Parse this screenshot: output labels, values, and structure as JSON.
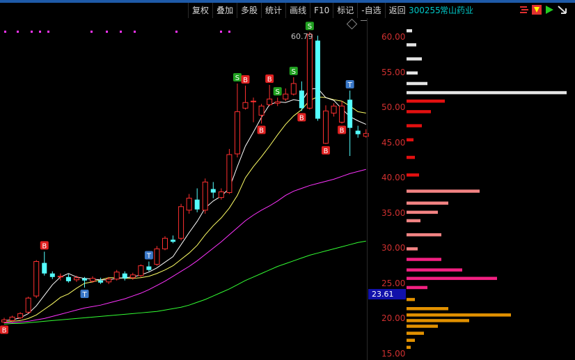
{
  "toolbar": {
    "buttons": [
      "复权",
      "叠加",
      "多股",
      "统计",
      "画线",
      "F10",
      "标记",
      "-自选",
      "返回"
    ]
  },
  "stock": {
    "code": "300255",
    "name": "常山药业"
  },
  "icons": [
    "grid-icon",
    "flag-icon",
    "play-icon",
    "arrow-icon"
  ],
  "colors": {
    "up": "#ff3030",
    "down": "#54ffff",
    "ma5": "#ffffff",
    "ma10": "#ffff66",
    "ma20": "#ff33ff",
    "ma60": "#33ff33",
    "axis": "#d03030"
  },
  "chart_data": {
    "type": "candlestick",
    "y_ticks": [
      "60.00",
      "55.00",
      "50.00",
      "45.00",
      "40.00",
      "35.00",
      "30.00",
      "25.00",
      "20.00",
      "15.00"
    ],
    "y_tick_values": [
      60,
      55,
      50,
      45,
      40,
      35,
      30,
      25,
      20,
      15
    ],
    "ylim": [
      14.2,
      62.8
    ],
    "max_price_label": "60.79",
    "current_price_label": "23.61",
    "candles": [
      [
        19.6,
        19.9,
        19.4,
        20.2
      ],
      [
        19.8,
        20.3,
        19.6,
        20.5
      ],
      [
        20.2,
        20.8,
        20.0,
        21.0
      ],
      [
        21.0,
        23.0,
        20.8,
        23.2
      ],
      [
        23.3,
        28.2,
        23.0,
        28.4
      ],
      [
        28.0,
        26.5,
        26.2,
        29.6
      ],
      [
        26.5,
        26.0,
        25.7,
        26.8
      ],
      [
        26.0,
        26.1,
        25.5,
        26.5
      ],
      [
        26.0,
        25.4,
        25.2,
        26.4
      ],
      [
        25.6,
        25.9,
        25.3,
        26.2
      ],
      [
        25.8,
        25.5,
        24.5,
        26.0
      ],
      [
        25.4,
        25.8,
        25.2,
        26.1
      ],
      [
        25.5,
        25.2,
        25.0,
        25.9
      ],
      [
        25.3,
        25.7,
        25.0,
        26.0
      ],
      [
        25.7,
        26.7,
        25.5,
        27.0
      ],
      [
        26.5,
        25.8,
        25.5,
        26.8
      ],
      [
        25.9,
        26.3,
        25.6,
        26.6
      ],
      [
        26.2,
        27.6,
        26.0,
        27.8
      ],
      [
        27.5,
        27.0,
        26.8,
        28.2
      ],
      [
        27.8,
        30.0,
        27.6,
        30.4
      ],
      [
        30.0,
        31.5,
        29.8,
        31.8
      ],
      [
        31.3,
        31.0,
        30.8,
        31.9
      ],
      [
        31.5,
        36.0,
        31.2,
        36.4
      ],
      [
        35.5,
        37.2,
        35.0,
        37.8
      ],
      [
        37.0,
        35.6,
        35.2,
        38.6
      ],
      [
        35.5,
        39.5,
        35.0,
        40.0
      ],
      [
        38.5,
        38.0,
        37.2,
        39.5
      ],
      [
        37.3,
        38.1,
        37.0,
        38.6
      ],
      [
        38.0,
        43.4,
        37.8,
        44.2
      ],
      [
        43.5,
        49.5,
        43.0,
        53.5
      ],
      [
        50.0,
        50.8,
        49.8,
        53.2
      ],
      [
        51.0,
        51.0,
        48.0,
        51.5
      ],
      [
        49.0,
        50.3,
        47.8,
        50.6
      ],
      [
        50.5,
        51.3,
        50.3,
        53.3
      ],
      [
        50.7,
        50.9,
        50.3,
        51.5
      ],
      [
        51.3,
        52.0,
        51.0,
        52.8
      ],
      [
        52.0,
        53.5,
        51.8,
        54.4
      ],
      [
        52.5,
        50.0,
        49.6,
        53.8
      ],
      [
        50.0,
        60.5,
        49.8,
        60.8
      ],
      [
        59.6,
        48.5,
        48.2,
        60.3
      ],
      [
        45.0,
        49.6,
        44.9,
        50.4
      ],
      [
        49.3,
        50.3,
        48.8,
        50.7
      ],
      [
        48.0,
        50.3,
        47.8,
        51.0
      ],
      [
        51.2,
        47.2,
        43.2,
        52.5
      ],
      [
        46.8,
        46.3,
        45.8,
        47.5
      ],
      [
        46.0,
        46.4,
        45.8,
        47.0
      ]
    ],
    "ma5": [
      19.8,
      19.9,
      20.2,
      20.8,
      21.9,
      23.4,
      24.9,
      26.0,
      26.5,
      26.0,
      25.8,
      25.7,
      25.6,
      25.6,
      25.8,
      25.9,
      26.0,
      26.3,
      26.7,
      27.3,
      28.1,
      28.9,
      30.6,
      32.3,
      33.9,
      35.8,
      36.8,
      37.5,
      38.6,
      41.7,
      44.6,
      46.6,
      48.7,
      50.5,
      50.9,
      50.8,
      51.2,
      51.0,
      52.7,
      52.8,
      51.5,
      51.1,
      49.9,
      48.8,
      48.2,
      47.7
    ],
    "ma10": [
      19.6,
      19.7,
      19.8,
      20.1,
      20.6,
      21.4,
      22.2,
      23.1,
      23.6,
      24.4,
      25.1,
      25.3,
      25.6,
      25.9,
      25.9,
      25.8,
      25.8,
      25.9,
      26.1,
      26.5,
      27.0,
      27.6,
      28.5,
      29.4,
      30.5,
      32.0,
      33.3,
      34.4,
      35.8,
      37.6,
      40.1,
      41.7,
      43.1,
      44.6,
      46.2,
      47.7,
      48.9,
      49.8,
      51.1,
      51.6,
      51.5,
      51.2,
      51.0,
      50.3,
      49.5,
      49.3
    ],
    "ma20": [
      19.5,
      19.5,
      19.6,
      19.7,
      19.9,
      20.1,
      20.4,
      20.7,
      21.0,
      21.3,
      21.6,
      21.8,
      22.0,
      22.3,
      22.6,
      22.9,
      23.3,
      23.7,
      24.2,
      24.8,
      25.4,
      26.1,
      26.8,
      27.5,
      28.3,
      29.2,
      30.1,
      31.0,
      32.0,
      33.0,
      34.0,
      34.8,
      35.5,
      36.1,
      36.8,
      37.6,
      38.2,
      38.6,
      39.0,
      39.3,
      39.6,
      39.9,
      40.3,
      40.7,
      41.0,
      41.3
    ],
    "ma60": [
      19.3,
      19.4,
      19.4,
      19.5,
      19.6,
      19.7,
      19.8,
      19.9,
      20.0,
      20.1,
      20.2,
      20.3,
      20.4,
      20.5,
      20.6,
      20.7,
      20.8,
      20.9,
      21.0,
      21.1,
      21.3,
      21.5,
      21.7,
      22.0,
      22.4,
      22.8,
      23.3,
      23.8,
      24.3,
      24.9,
      25.5,
      26.0,
      26.5,
      27.0,
      27.5,
      27.9,
      28.3,
      28.7,
      29.1,
      29.4,
      29.7,
      30.0,
      30.3,
      30.6,
      30.9,
      31.1
    ],
    "markers": [
      {
        "i": 0,
        "label": "B",
        "color": "#e02020",
        "pos": "below"
      },
      {
        "i": 5,
        "label": "B",
        "color": "#e02020",
        "pos": "above"
      },
      {
        "i": 10,
        "label": "T",
        "color": "#3a78c8",
        "pos": "below"
      },
      {
        "i": 18,
        "label": "T",
        "color": "#3a78c8",
        "pos": "above"
      },
      {
        "i": 29,
        "label": "S",
        "color": "#20a020",
        "pos": "above"
      },
      {
        "i": 30,
        "label": "B",
        "color": "#e02020",
        "pos": "above"
      },
      {
        "i": 32,
        "label": "B",
        "color": "#e02020",
        "pos": "below"
      },
      {
        "i": 33,
        "label": "B",
        "color": "#e02020",
        "pos": "above"
      },
      {
        "i": 34,
        "label": "S",
        "color": "#20a020",
        "pos": "above"
      },
      {
        "i": 36,
        "label": "S",
        "color": "#20a020",
        "pos": "above"
      },
      {
        "i": 37,
        "label": "B",
        "color": "#e02020",
        "pos": "below"
      },
      {
        "i": 38,
        "label": "S",
        "color": "#20a020",
        "pos": "above"
      },
      {
        "i": 40,
        "label": "B",
        "color": "#e02020",
        "pos": "below"
      },
      {
        "i": 42,
        "label": "B",
        "color": "#e02020",
        "pos": "below"
      },
      {
        "i": 43,
        "label": "T",
        "color": "#3a78c8",
        "pos": "above"
      }
    ],
    "volume_profile": [
      {
        "price": 61.0,
        "w": 8,
        "color": "#f0f0f0"
      },
      {
        "price": 59.0,
        "w": 14,
        "color": "#f0f0f0"
      },
      {
        "price": 57.0,
        "w": 22,
        "color": "#f0f0f0"
      },
      {
        "price": 55.0,
        "w": 16,
        "color": "#f0f0f0"
      },
      {
        "price": 53.5,
        "w": 30,
        "color": "#f0f0f0"
      },
      {
        "price": 52.2,
        "w": 230,
        "color": "#f0f0f0"
      },
      {
        "price": 51.0,
        "w": 55,
        "color": "#ee1111"
      },
      {
        "price": 49.5,
        "w": 35,
        "color": "#ee1111"
      },
      {
        "price": 47.5,
        "w": 22,
        "color": "#ee1111"
      },
      {
        "price": 45.5,
        "w": 10,
        "color": "#ee1111"
      },
      {
        "price": 43.0,
        "w": 12,
        "color": "#ee1111"
      },
      {
        "price": 40.5,
        "w": 18,
        "color": "#ee1111"
      },
      {
        "price": 38.2,
        "w": 105,
        "color": "#ff8a8a"
      },
      {
        "price": 36.5,
        "w": 60,
        "color": "#ff8a8a"
      },
      {
        "price": 35.2,
        "w": 45,
        "color": "#ff8a8a"
      },
      {
        "price": 34.0,
        "w": 20,
        "color": "#ff8a8a"
      },
      {
        "price": 32.0,
        "w": 50,
        "color": "#ff8a8a"
      },
      {
        "price": 30.0,
        "w": 16,
        "color": "#ff8a8a"
      },
      {
        "price": 28.5,
        "w": 50,
        "color": "#ff2288"
      },
      {
        "price": 27.0,
        "w": 80,
        "color": "#ff2288"
      },
      {
        "price": 25.8,
        "w": 130,
        "color": "#ff2288"
      },
      {
        "price": 24.5,
        "w": 30,
        "color": "#ff2288"
      },
      {
        "price": 22.8,
        "w": 12,
        "color": "#ee9900"
      },
      {
        "price": 21.5,
        "w": 60,
        "color": "#ee9900"
      },
      {
        "price": 20.6,
        "w": 150,
        "color": "#ee9900"
      },
      {
        "price": 19.8,
        "w": 90,
        "color": "#ee9900"
      },
      {
        "price": 19.0,
        "w": 45,
        "color": "#ee9900"
      },
      {
        "price": 18.0,
        "w": 25,
        "color": "#ee9900"
      },
      {
        "price": 17.0,
        "w": 12,
        "color": "#ee9900"
      },
      {
        "price": 16.0,
        "w": 6,
        "color": "#ee9900"
      }
    ]
  }
}
